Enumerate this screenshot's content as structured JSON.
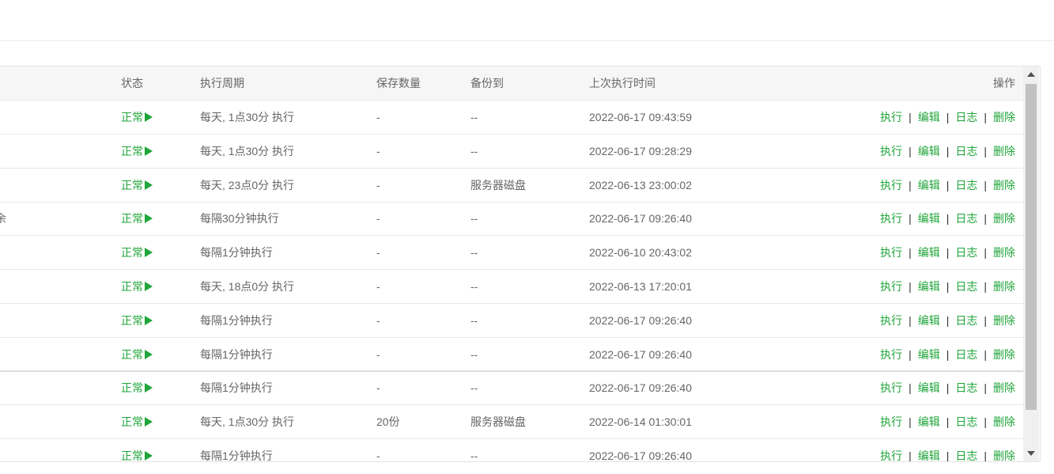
{
  "table": {
    "headers": {
      "status": "状态",
      "cycle": "执行周期",
      "save_count": "保存数量",
      "backup_to": "备份到",
      "last_exec": "上次执行时间",
      "actions": "操作"
    },
    "actions": {
      "run": "执行",
      "edit": "编辑",
      "log": "日志",
      "delete": "删除",
      "separator": "|"
    },
    "rows": [
      {
        "name": "",
        "status": "正常",
        "cycle": "每天, 1点30分 执行",
        "save_count": "-",
        "backup_to": "--",
        "last_exec": "2022-06-17 09:43:59"
      },
      {
        "name": "",
        "status": "正常",
        "cycle": "每天, 1点30分 执行",
        "save_count": "-",
        "backup_to": "--",
        "last_exec": "2022-06-17 09:28:29"
      },
      {
        "name": "",
        "status": "正常",
        "cycle": "每天, 23点0分 执行",
        "save_count": "-",
        "backup_to": "服务器磁盘",
        "last_exec": "2022-06-13 23:00:02"
      },
      {
        "name": "余",
        "status": "正常",
        "cycle": "每隔30分钟执行",
        "save_count": "-",
        "backup_to": "--",
        "last_exec": "2022-06-17 09:26:40"
      },
      {
        "name": "",
        "status": "正常",
        "cycle": "每隔1分钟执行",
        "save_count": "-",
        "backup_to": "--",
        "last_exec": "2022-06-10 20:43:02"
      },
      {
        "name": "",
        "status": "正常",
        "cycle": "每天, 18点0分 执行",
        "save_count": "-",
        "backup_to": "--",
        "last_exec": "2022-06-13 17:20:01"
      },
      {
        "name": "",
        "status": "正常",
        "cycle": "每隔1分钟执行",
        "save_count": "-",
        "backup_to": "--",
        "last_exec": "2022-06-17 09:26:40"
      },
      {
        "name": "",
        "status": "正常",
        "cycle": "每隔1分钟执行",
        "save_count": "-",
        "backup_to": "--",
        "last_exec": "2022-06-17 09:26:40"
      },
      {
        "name": "",
        "status": "正常",
        "cycle": "每隔1分钟执行",
        "save_count": "-",
        "backup_to": "--",
        "last_exec": "2022-06-17 09:26:40"
      },
      {
        "name": "",
        "status": "正常",
        "cycle": "每天, 1点30分 执行",
        "save_count": "20份",
        "backup_to": "服务器磁盘",
        "last_exec": "2022-06-14 01:30:01"
      },
      {
        "name": "",
        "status": "正常",
        "cycle": "每隔1分钟执行",
        "save_count": "-",
        "backup_to": "--",
        "last_exec": "2022-06-17 09:26:40"
      }
    ]
  },
  "colors": {
    "accent": "#20a53a",
    "header_bg": "#f6f6f6",
    "border": "#e8e8e8"
  },
  "icons": {
    "status_play": "play-triangle-icon",
    "scroll_up": "scroll-up-arrow-icon",
    "scroll_down": "scroll-down-arrow-icon"
  }
}
